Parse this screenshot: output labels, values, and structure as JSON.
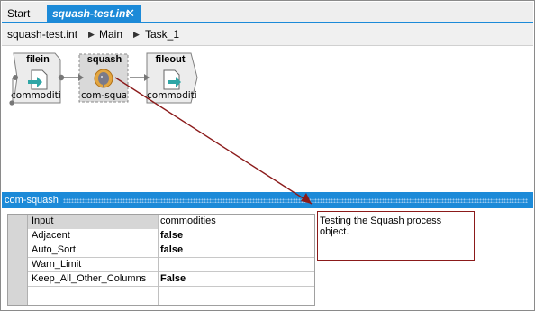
{
  "tabs": [
    {
      "label": "Start",
      "active": false
    },
    {
      "label": "squash-test.int",
      "active": true,
      "close_glyph": "✕"
    }
  ],
  "breadcrumb": {
    "items": [
      "squash-test.int",
      "Main",
      "Task_1"
    ],
    "separator": "▶"
  },
  "nodes": [
    {
      "title": "filein",
      "subtitle": "commoditi",
      "icon": "arrow-into-doc-icon"
    },
    {
      "title": "squash",
      "subtitle": "com-squa",
      "icon": "elephant-icon",
      "selected": true
    },
    {
      "title": "fileout",
      "subtitle": "commoditi",
      "icon": "arrow-out-doc-icon"
    }
  ],
  "panel": {
    "title": "com-squash"
  },
  "properties": [
    {
      "name": "Input",
      "value": "commodities",
      "bold": false
    },
    {
      "name": "Adjacent",
      "value": "false",
      "bold": true
    },
    {
      "name": "Auto_Sort",
      "value": "false",
      "bold": true
    },
    {
      "name": "Warn_Limit",
      "value": "",
      "bold": false
    },
    {
      "name": "Keep_All_Other_Columns",
      "value": "False",
      "bold": true
    }
  ],
  "description": "Testing the Squash process object.",
  "colors": {
    "accent": "#1c8ad8",
    "annotation": "#8b1a1a"
  }
}
